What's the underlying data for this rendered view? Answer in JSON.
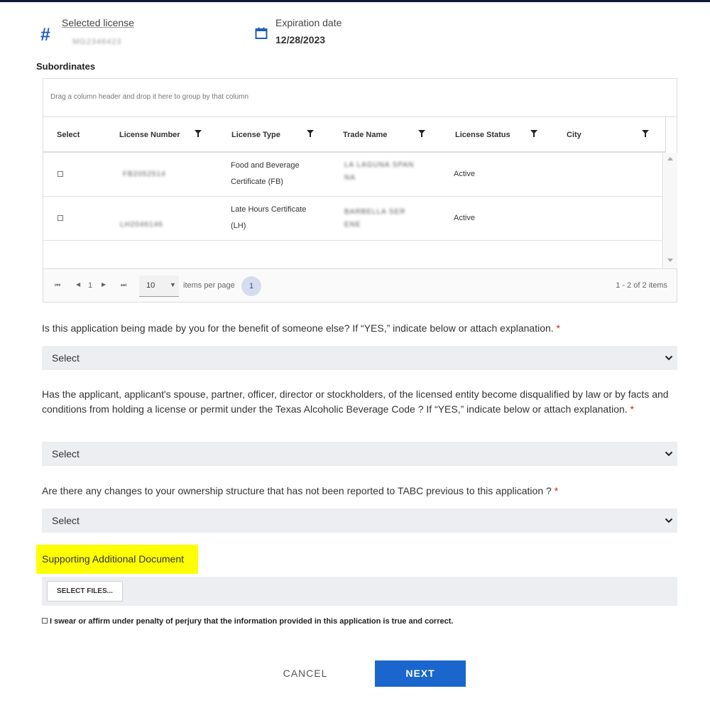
{
  "license": {
    "selected_label": "Selected license",
    "selected_value": "MG2346423",
    "expiration_label": "Expiration date",
    "expiration_value": "12/28/2023",
    "icons": {
      "number": "hash-icon",
      "date": "calendar-icon"
    }
  },
  "subordinates": {
    "title": "Subordinates",
    "group_hint": "Drag a column header and drop it here to group by that column",
    "columns": [
      "Select",
      "License Number",
      "License Type",
      "Trade Name",
      "License Status",
      "City"
    ],
    "rows": [
      {
        "license_number": "FB2052514",
        "license_type_line1": "Food and Beverage",
        "license_type_line2": "Certificate (FB)",
        "trade_name_line1": "LA LAGUNA SPAN",
        "trade_name_line2": "NA",
        "status": "Active",
        "city": ""
      },
      {
        "license_number": "LH2046146",
        "license_type_line1": "Late Hours Certificate",
        "license_type_line2": "(LH)",
        "trade_name_line1": "BARBELLA SER",
        "trade_name_line2": "ENE",
        "status": "Active",
        "city": ""
      }
    ],
    "pager": {
      "current_page": "1",
      "page_size": "10",
      "items_per_page_label": "items per page",
      "badge": "1",
      "count_text": "1 - 2 of 2 items"
    }
  },
  "questions": [
    {
      "text": "Is this application being made by you for the benefit of someone else? If “YES,” indicate below or attach explanation.",
      "required": "*",
      "selected": "Select"
    },
    {
      "text": "Has the applicant, applicant's spouse, partner, officer, director or stockholders, of the licensed entity become disqualified by law or by facts and conditions from holding a license or permit under the Texas Alcoholic Beverage Code ? If “YES,” indicate below or attach explanation.",
      "required": "*",
      "selected": "Select"
    },
    {
      "text": "Are there any changes to your ownership structure that has not been reported to TABC previous to this application ?",
      "required": "*",
      "selected": "Select"
    }
  ],
  "supporting": {
    "label": "Supporting Additional Document",
    "select_files": "SELECT FILES..."
  },
  "affirm": "I swear or affirm under penalty of perjury that the information provided in this application is true and correct.",
  "actions": {
    "cancel": "CANCEL",
    "next": "NEXT"
  },
  "colors": {
    "accent": "#1a66cc",
    "highlight": "#ffff00",
    "required": "#d02020"
  }
}
